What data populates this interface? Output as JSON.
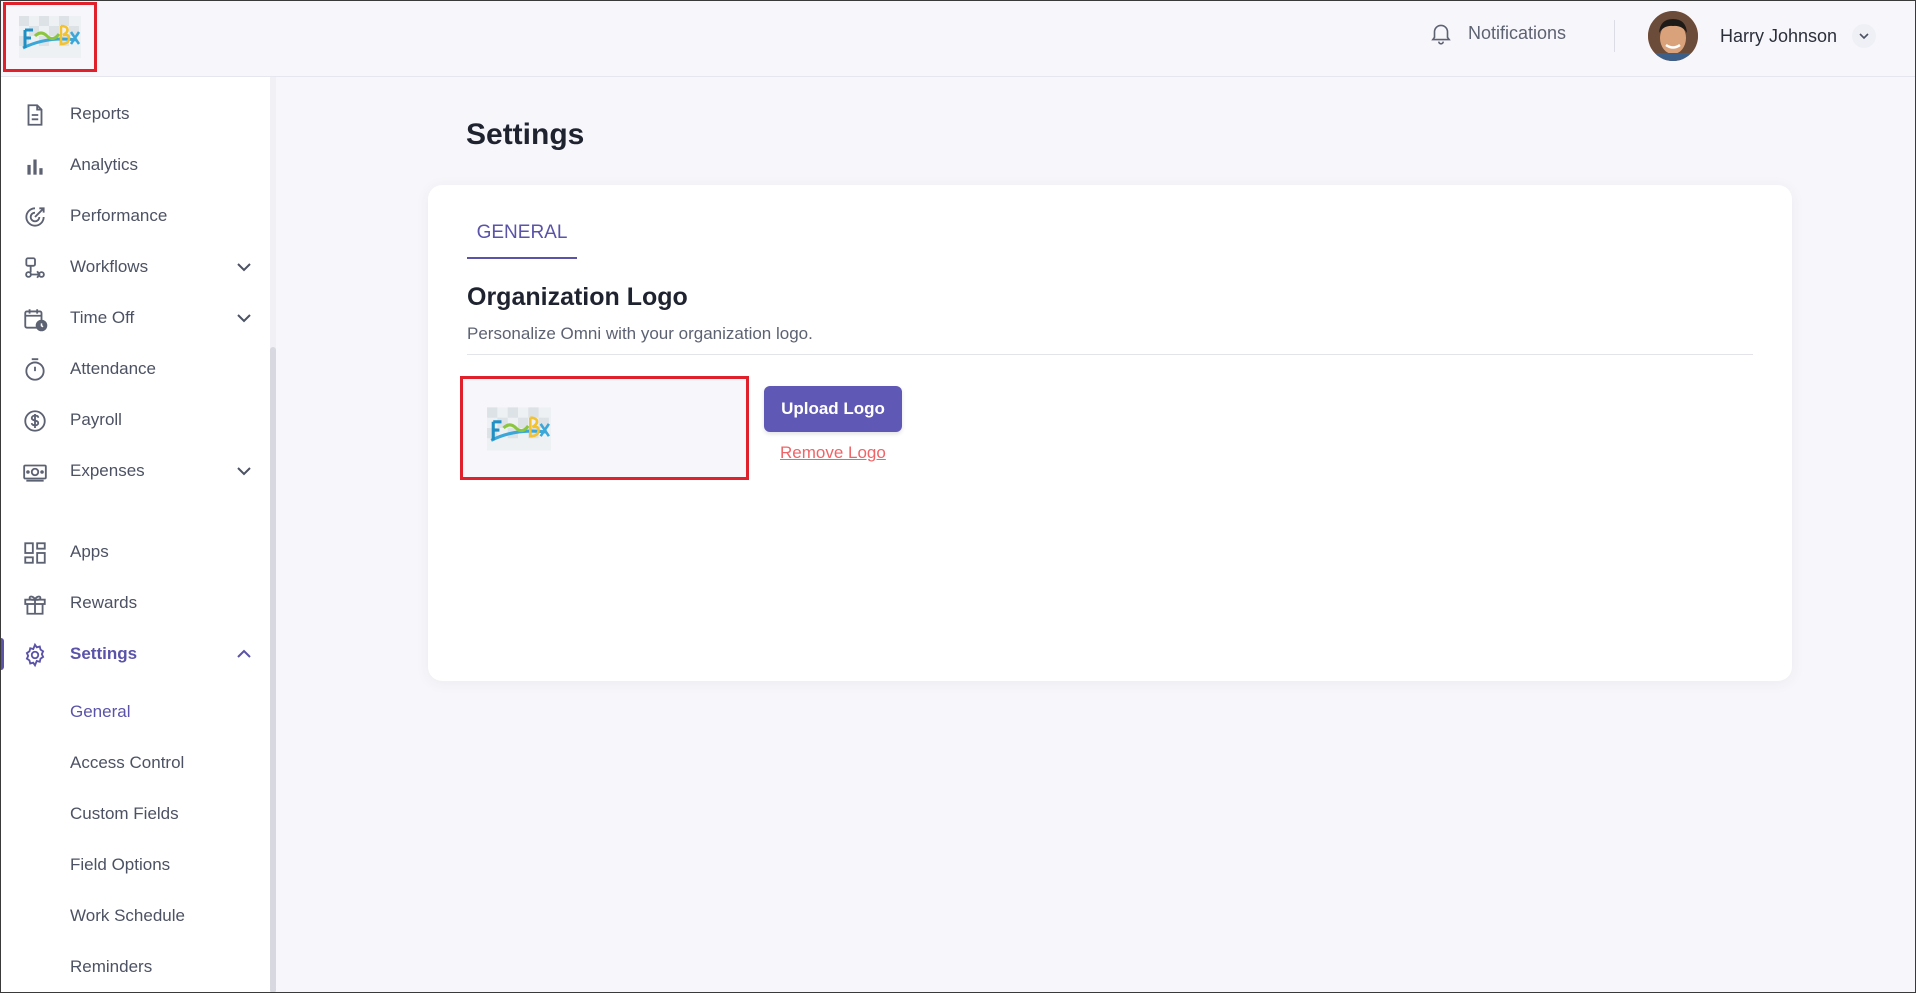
{
  "brand": {
    "logo_text": "FreshBox"
  },
  "header": {
    "notifications_label": "Notifications",
    "user_name": "Harry Johnson"
  },
  "sidebar": {
    "items": [
      {
        "label": "Reports",
        "icon": "document-icon"
      },
      {
        "label": "Analytics",
        "icon": "bar-chart-icon"
      },
      {
        "label": "Performance",
        "icon": "performance-icon"
      },
      {
        "label": "Workflows",
        "icon": "workflow-icon",
        "expandable": true
      },
      {
        "label": "Time Off",
        "icon": "calendar-clock-icon",
        "expandable": true
      },
      {
        "label": "Attendance",
        "icon": "stopwatch-icon"
      },
      {
        "label": "Payroll",
        "icon": "dollar-icon"
      },
      {
        "label": "Expenses",
        "icon": "money-icon",
        "expandable": true
      },
      {
        "label": "Apps",
        "icon": "apps-grid-icon"
      },
      {
        "label": "Rewards",
        "icon": "gift-icon"
      },
      {
        "label": "Settings",
        "icon": "gear-icon",
        "expandable": true,
        "expanded": true,
        "active": true
      }
    ],
    "settings_sub": [
      "General",
      "Access Control",
      "Custom Fields",
      "Field Options",
      "Work Schedule",
      "Reminders"
    ]
  },
  "main": {
    "title": "Settings",
    "tabs": [
      "GENERAL"
    ],
    "section_title": "Organization Logo",
    "section_subtitle": "Personalize Omni with your organization logo.",
    "upload_label": "Upload Logo",
    "remove_label": "Remove Logo"
  },
  "colors": {
    "accent": "#5a53a8",
    "button": "#5f58b5",
    "danger_link": "#f06467",
    "highlight_border": "#e0202a",
    "page_bg": "#f7f7fb"
  }
}
